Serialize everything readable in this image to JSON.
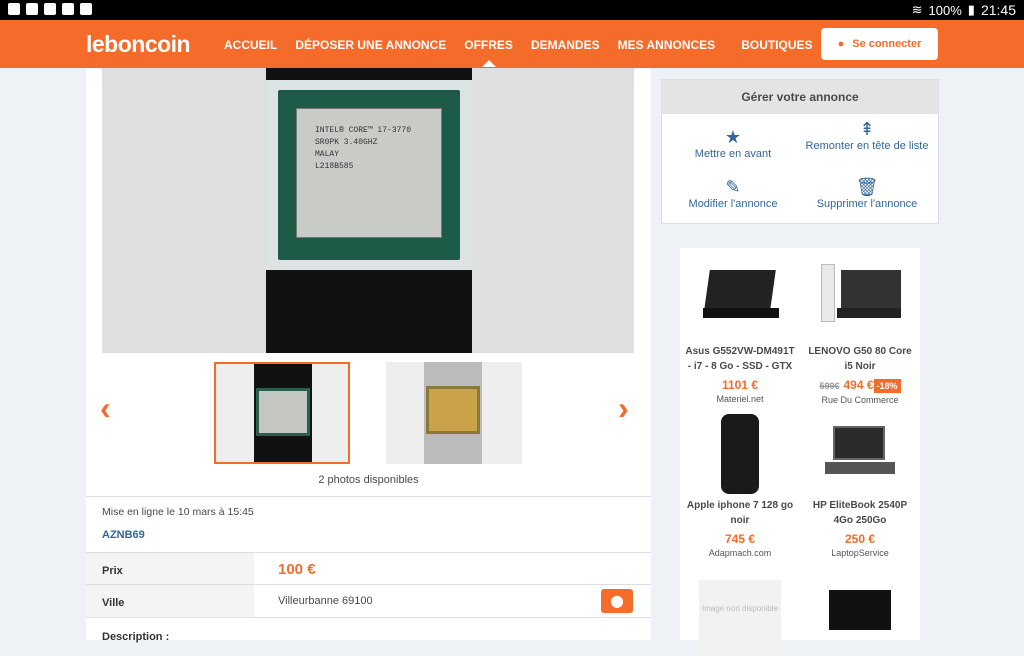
{
  "status": {
    "battery": "100%",
    "time": "21:45"
  },
  "nav": {
    "logo": "leboncoin",
    "items": [
      "ACCUEIL",
      "DÉPOSER UNE ANNONCE",
      "OFFRES",
      "DEMANDES",
      "MES ANNONCES",
      "BOUTIQUES"
    ],
    "active": "OFFRES",
    "login": "Se connecter"
  },
  "gallery": {
    "chip_text": [
      "INTEL® CORE™ i7-3770",
      "SR0PK 3.40GHZ",
      "MALAY",
      "L218B585"
    ],
    "count": "2 photos disponibles"
  },
  "listing": {
    "posted": "Mise en ligne le 10 mars à 15:45",
    "seller": "AZNB69",
    "price_label": "Prix",
    "price": "100 €",
    "city_label": "Ville",
    "city": "Villeurbanne 69100",
    "description_label": "Description :"
  },
  "manage": {
    "title": "Gérer votre annonce",
    "actions": [
      "Mettre en avant",
      "Remonter en tête de liste",
      "Modifier l'annonce",
      "Supprimer l'annonce"
    ]
  },
  "ads": [
    {
      "name": "Asus G552VW-DM491T - i7 - 8 Go - SSD - GTX",
      "price": "1101 €",
      "shop": "Materiel.net"
    },
    {
      "name": "LENOVO G50 80 Core i5 Noir",
      "old": "599€",
      "price": "494 €",
      "discount": "-18%",
      "shop": "Rue Du Commerce"
    },
    {
      "name": "Apple iphone 7 128 go noir",
      "price": "745 €",
      "shop": "Adapmach.com"
    },
    {
      "name": "HP EliteBook 2540P 4Go 250Go",
      "price": "250 €",
      "shop": "LaptopService"
    },
    {
      "placeholder": "Image non disponible"
    }
  ],
  "colors": {
    "brand": "#f56b2a",
    "link": "#336699"
  }
}
